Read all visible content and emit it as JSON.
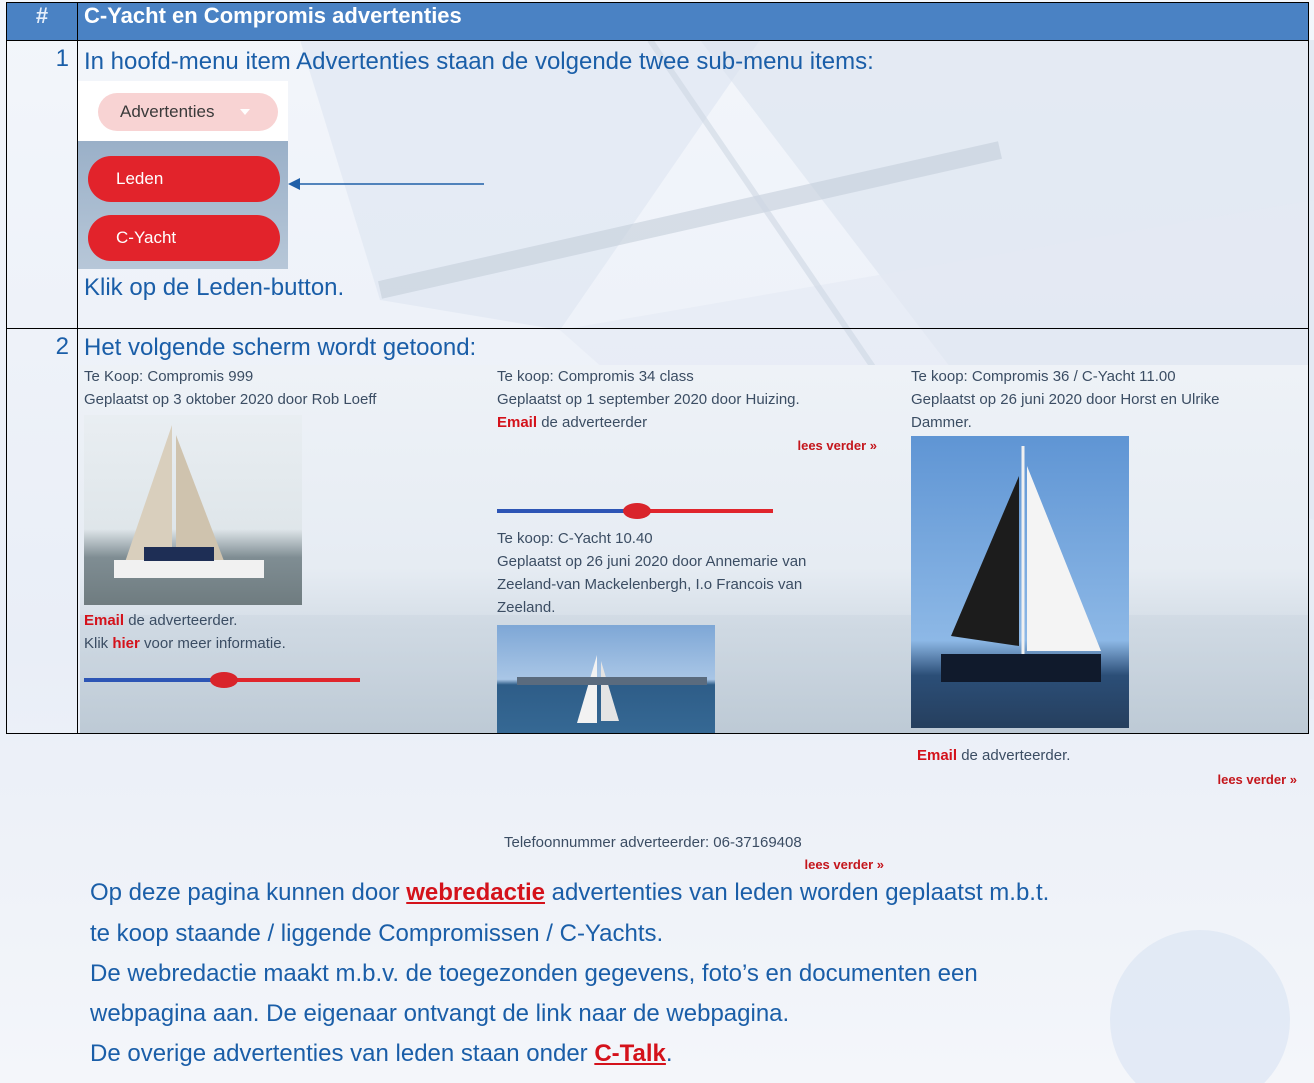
{
  "table": {
    "col_num": "#",
    "title": "C-Yacht en Compromis advertenties"
  },
  "row1": {
    "num": "1",
    "intro": "In hoofd-menu item Advertenties staan de volgende twee sub-menu items:",
    "menu": {
      "top": "Advertenties",
      "items": [
        "Leden",
        "C-Yacht"
      ]
    },
    "instruction": "Klik op de Leden-button."
  },
  "row2": {
    "num": "2",
    "intro": "Het volgende scherm wordt getoond:",
    "ads": [
      {
        "title": "Te Koop: Compromis 999",
        "posted": "Geplaatst op 3 oktober 2020 door Rob Loeff",
        "email_word": "Email",
        "email_rest": " de adverteerder.",
        "info_pre": "Klik ",
        "info_link": "hier",
        "info_post": " voor meer informatie."
      },
      {
        "title": "Te koop: Compromis 34 class",
        "posted": "Geplaatst op 1 september 2020 door Huizing.",
        "email_word": "Email",
        "email_rest": " de adverteerder",
        "more": "lees verder »"
      },
      {
        "title": "Te koop: Compromis 36 / C-Yacht 11.00",
        "posted_1": "Geplaatst op 26 juni 2020 door Horst en Ulrike",
        "posted_2": "Dammer.",
        "email_word": "Email",
        "email_rest": " de adverteerder.",
        "more": "lees verder »"
      },
      {
        "title": "Te koop: C-Yacht 10.40",
        "posted_1": "Geplaatst op 26 juni 2020 door Annemarie van",
        "posted_2": "Zeeland-van Mackelenbergh, I.o Francois van",
        "posted_3": "Zeeland.",
        "phone": "Telefoonnummer adverteerder: 06-37169408",
        "more": "lees verder »"
      }
    ],
    "text": {
      "p1_pre": "Op deze pagina kunnen door ",
      "p1_link": "webredactie",
      "p1_post": " advertenties van leden worden geplaatst m.b.t.",
      "p2": "te koop staande / liggende Compromissen / C-Yachts.",
      "p3": "De webredactie maakt m.b.v. de toegezonden gegevens, foto’s en documenten een",
      "p4": "webpagina aan. De eigenaar ontvangt de link naar de webpagina.",
      "p5_pre": "De overige advertenties van leden staan onder ",
      "p5_link": "C-Talk",
      "p5_post": "."
    }
  },
  "colors": {
    "header": "#4a82c4",
    "text": "#1a5ea8",
    "accent_red": "#e2232b",
    "link_red": "#d4121b"
  }
}
